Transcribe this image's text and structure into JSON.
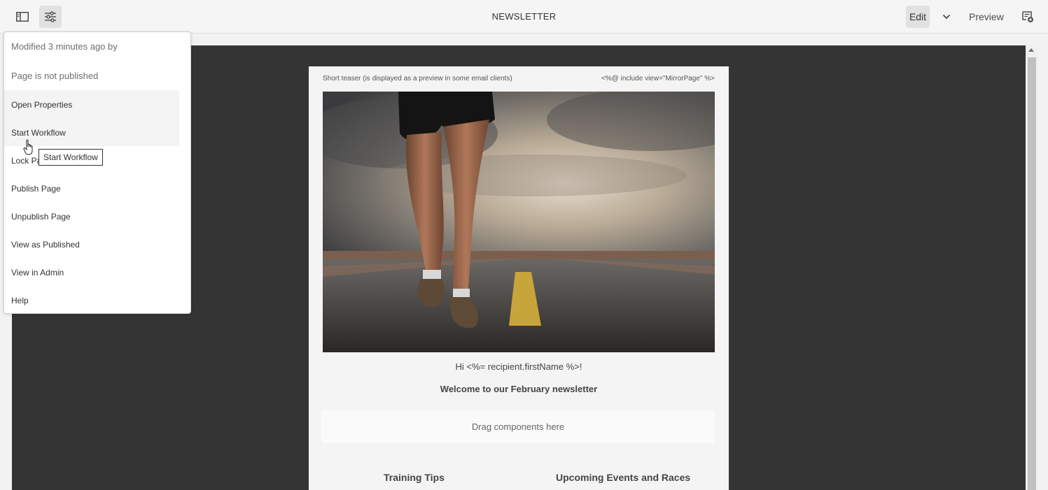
{
  "topbar": {
    "title": "NEWSLETTER",
    "edit_label": "Edit",
    "preview_label": "Preview",
    "icons": [
      "sidepanel-icon",
      "page-properties-icon",
      "chevron-down-icon",
      "annotate-icon"
    ]
  },
  "popover": {
    "modified": "Modified 3 minutes ago by",
    "status": "Page is not published",
    "items": [
      {
        "label": "Open Properties"
      },
      {
        "label": "Start Workflow"
      },
      {
        "label": "Lock Page"
      },
      {
        "label": "Publish Page"
      },
      {
        "label": "Unpublish Page"
      },
      {
        "label": "View as Published"
      },
      {
        "label": "View in Admin"
      },
      {
        "label": "Help"
      }
    ],
    "tooltip": "Start Workflow",
    "lock_visible_text": "Lock Pa"
  },
  "email": {
    "teaser": "Short teaser (is displayed as a preview in some email clients)",
    "mirror": "<%@ include view=\"MirrorPage\" %>",
    "hero_alt": "runner-on-road-image",
    "greeting": "Hi <%= recipient.firstName %>!",
    "welcome": "Welcome to our February newsletter",
    "dropzone": "Drag components here",
    "columns": [
      "Training Tips",
      "Upcoming Events and Races"
    ]
  },
  "colors": {
    "canvas": "#343434",
    "toolbar": "#f5f5f5",
    "accent": "#e1e1e1"
  }
}
